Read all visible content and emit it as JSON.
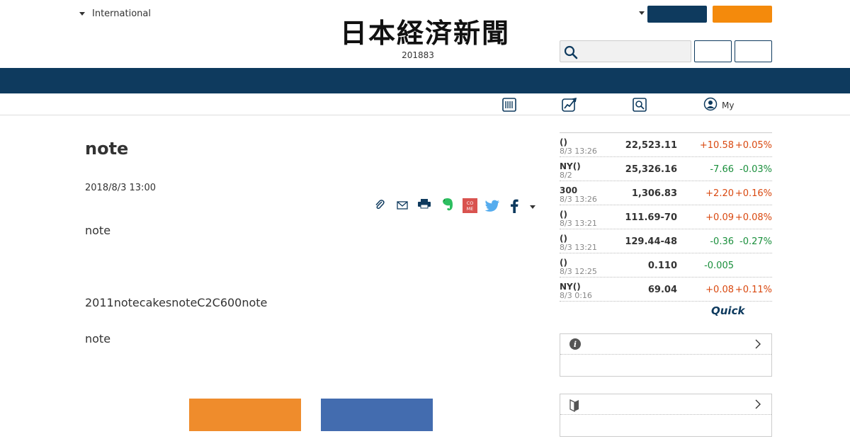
{
  "header": {
    "edition_selector": "International",
    "logo_text": "日本経済新聞",
    "edition_date": "201883",
    "search": {
      "value": "",
      "placeholder": ""
    }
  },
  "subnav": {
    "items": [
      {
        "icon": "newspaper-icon",
        "label": ""
      },
      {
        "icon": "chart-icon",
        "label": ""
      },
      {
        "icon": "search-doc-icon",
        "label": ""
      },
      {
        "icon": "user-icon",
        "label": "My"
      }
    ]
  },
  "article": {
    "title": "note",
    "published": "2018/8/3 13:00",
    "paragraphs": [
      "note",
      "2011notecakesnoteC2C600note",
      "note"
    ],
    "share_icons": [
      "clip-icon",
      "mail-icon",
      "print-icon",
      "evernote-icon",
      "come-icon",
      "twitter-icon",
      "facebook-icon",
      "more-caret-icon"
    ],
    "come_label": "CO ME"
  },
  "market": {
    "rows": [
      {
        "name": "()",
        "time": "8/3 13:26",
        "value": "22,523.11",
        "change": "+10.58",
        "pct": "+0.05%",
        "dir": "up"
      },
      {
        "name": "NY()",
        "time": "8/2",
        "value": "25,326.16",
        "change": "-7.66",
        "pct": "-0.03%",
        "dir": "down"
      },
      {
        "name": "300",
        "time": "8/3 13:26",
        "value": "1,306.83",
        "change": "+2.20",
        "pct": "+0.16%",
        "dir": "up"
      },
      {
        "name": "()",
        "time": "8/3 13:21",
        "value": "111.69-70",
        "change": "+0.09",
        "pct": "+0.08%",
        "dir": "up"
      },
      {
        "name": "()",
        "time": "8/3 13:21",
        "value": "129.44-48",
        "change": "-0.36",
        "pct": "-0.27%",
        "dir": "down"
      },
      {
        "name": "()",
        "time": "8/3 12:25",
        "value": "0.110",
        "change": "-0.005",
        "pct": "",
        "dir": "down"
      },
      {
        "name": "NY()",
        "time": "8/3 0:16",
        "value": "69.04",
        "change": "+0.08",
        "pct": "+0.11%",
        "dir": "up"
      }
    ],
    "source_logo": "Quick"
  },
  "colors": {
    "navy": "#0e3a5e",
    "orange": "#f48a0c",
    "up": "#d9480f",
    "down": "#1a8f3c",
    "cta_orange": "#ef8c2c",
    "cta_blue": "#436caf"
  }
}
